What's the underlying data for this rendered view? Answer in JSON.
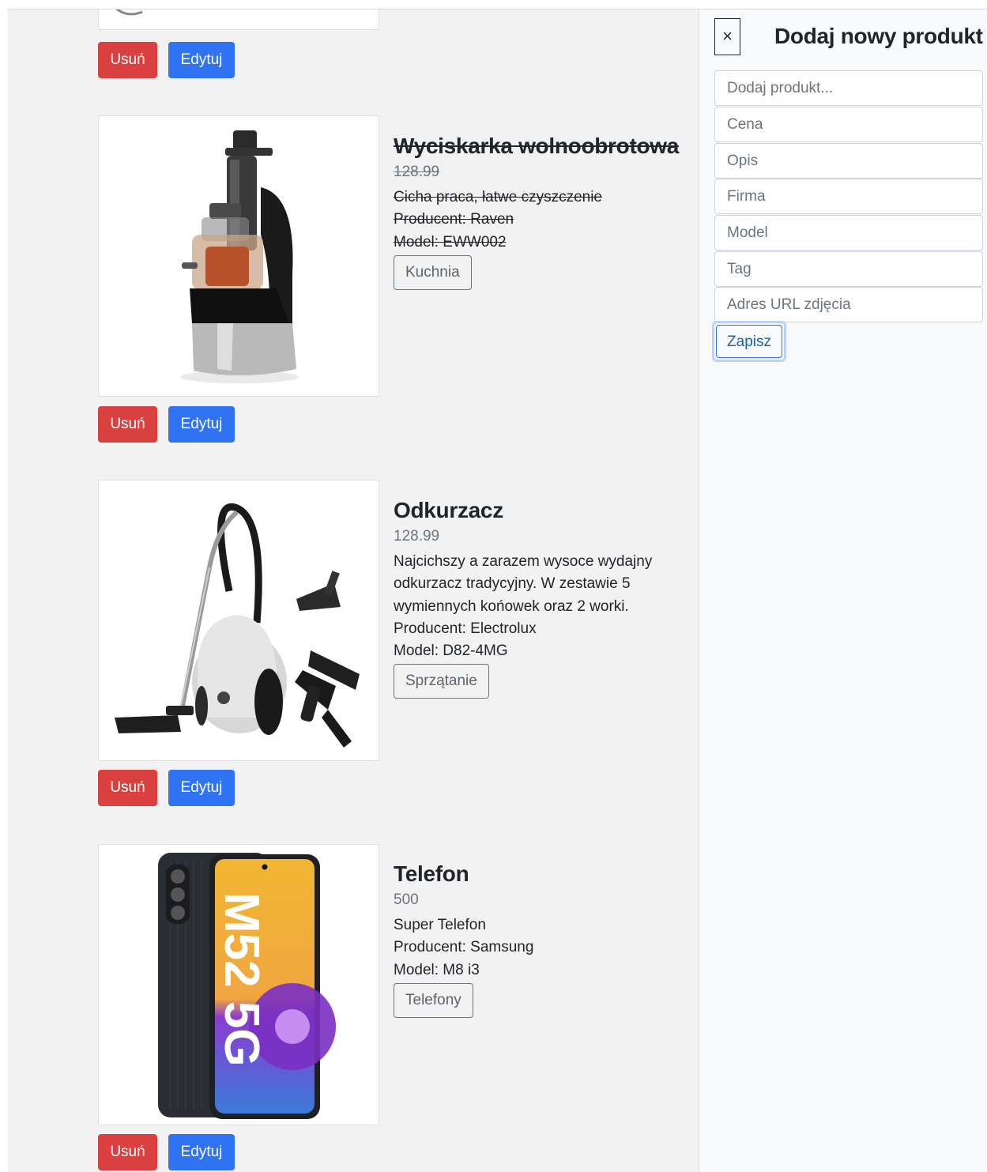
{
  "products": [
    {
      "name": "Wyciskarka wolnoobrotowa",
      "price": "128.99",
      "description": "Cicha praca, łatwe czyszczenie",
      "producer": "Producent: Raven",
      "model": "Model: EWW002",
      "tag": "Kuchnia",
      "completed": true,
      "image_icon": "juicer-image"
    },
    {
      "name": "Odkurzacz",
      "price": "128.99",
      "description": "Najcichszy a zarazem wysoce wydajny odkurzacz tradycyjny. W zestawie 5 wymiennych końowek oraz 2 worki.",
      "producer": "Producent: Electrolux",
      "model": "Model: D82-4MG",
      "tag": "Sprzątanie",
      "completed": false,
      "image_icon": "vacuum-cleaner-image"
    },
    {
      "name": "Telefon",
      "price": "500",
      "description": "Super Telefon",
      "producer": "Producent: Samsung",
      "model": "Model: M8 i3",
      "tag": "Telefony",
      "completed": false,
      "image_icon": "phone-image",
      "image_text": "M52 5G"
    }
  ],
  "buttons": {
    "delete_label": "Usuń",
    "edit_label": "Edytuj"
  },
  "panel": {
    "close_symbol": "×",
    "title": "Dodaj nowy produkt",
    "placeholders": {
      "name": "Dodaj produkt...",
      "price": "Cena",
      "description": "Opis",
      "company": "Firma",
      "model": "Model",
      "tag": "Tag",
      "image_url": "Adres URL zdjęcia"
    },
    "save_label": "Zapisz"
  },
  "colors": {
    "delete": "#d9403f",
    "edit": "#2f73f2",
    "page_bg": "#f2f2f3",
    "panel_bg": "#f8f9fa"
  }
}
